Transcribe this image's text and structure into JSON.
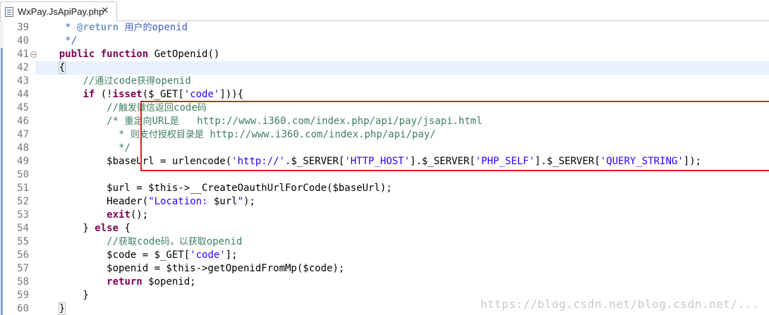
{
  "tab": {
    "title": "WxPay.JsApiPay.php",
    "close_glyph": "✕",
    "icon": "php-file-icon"
  },
  "lines": [
    {
      "num": "39",
      "tokens": [
        [
          "jd",
          "     * "
        ],
        [
          "jt",
          "@return"
        ],
        [
          "jd",
          " "
        ],
        [
          "jj",
          "用户的"
        ],
        [
          "jd",
          "openid"
        ]
      ]
    },
    {
      "num": "40",
      "tokens": [
        [
          "jd",
          "     */"
        ]
      ]
    },
    {
      "num": "41",
      "fold": true,
      "tokens": [
        [
          "var",
          "    "
        ],
        [
          "kw",
          "public"
        ],
        [
          "var",
          " "
        ],
        [
          "kw",
          "function"
        ],
        [
          "var",
          " GetOpenid()"
        ]
      ]
    },
    {
      "num": "42",
      "current": true,
      "tokens": [
        [
          "var",
          "    "
        ],
        [
          "brk",
          "{"
        ]
      ]
    },
    {
      "num": "43",
      "tokens": [
        [
          "var",
          "        "
        ],
        [
          "cm",
          "//"
        ],
        [
          "cj",
          "通过"
        ],
        [
          "cm",
          "code"
        ],
        [
          "cj",
          "获得"
        ],
        [
          "cm",
          "openid"
        ]
      ]
    },
    {
      "num": "44",
      "tokens": [
        [
          "var",
          "        "
        ],
        [
          "kw",
          "if"
        ],
        [
          "var",
          " (!"
        ],
        [
          "kw",
          "isset"
        ],
        [
          "var",
          "($_GET["
        ],
        [
          "str",
          "'code'"
        ],
        [
          "var",
          "])){"
        ]
      ]
    },
    {
      "num": "45",
      "tokens": [
        [
          "var",
          "            "
        ],
        [
          "cm",
          "//"
        ],
        [
          "cj",
          "触发微信返回"
        ],
        [
          "cm",
          "code"
        ],
        [
          "cj",
          "码"
        ]
      ]
    },
    {
      "num": "46",
      "tokens": [
        [
          "var",
          "            "
        ],
        [
          "cm",
          "/* "
        ],
        [
          "cj",
          "重定向"
        ],
        [
          "cm",
          "URL"
        ],
        [
          "cj",
          "是"
        ],
        [
          "cm",
          "   http://www.i360.com/index.php/api/pay/jsapi.html"
        ]
      ]
    },
    {
      "num": "47",
      "tokens": [
        [
          "var",
          "            "
        ],
        [
          "cm",
          "  * "
        ],
        [
          "cj",
          "则支付授权目录是"
        ],
        [
          "cm",
          " http://www.i360.com/index.php/api/pay/"
        ]
      ]
    },
    {
      "num": "48",
      "tokens": [
        [
          "var",
          "            "
        ],
        [
          "cm",
          "  */"
        ]
      ]
    },
    {
      "num": "49",
      "tokens": [
        [
          "var",
          "            $baseUrl = urlencode("
        ],
        [
          "str",
          "'http://'"
        ],
        [
          "var",
          ".$_SERVER["
        ],
        [
          "str",
          "'HTTP_HOST'"
        ],
        [
          "var",
          "].$_SERVER["
        ],
        [
          "str",
          "'PHP_SELF'"
        ],
        [
          "var",
          "].$_SERVER["
        ],
        [
          "str",
          "'QUERY_STRING'"
        ],
        [
          "var",
          "]);"
        ]
      ]
    },
    {
      "num": "50",
      "tokens": []
    },
    {
      "num": "51",
      "tokens": [
        [
          "var",
          "            $url = $this->__CreateOauthUrlForCode($baseUrl);"
        ]
      ]
    },
    {
      "num": "52",
      "tokens": [
        [
          "var",
          "            Header("
        ],
        [
          "str",
          "\"Location: "
        ],
        [
          "var",
          "$url"
        ],
        [
          "str",
          "\""
        ],
        [
          "var",
          ");"
        ]
      ]
    },
    {
      "num": "53",
      "tokens": [
        [
          "var",
          "            "
        ],
        [
          "kw",
          "exit"
        ],
        [
          "var",
          "();"
        ]
      ]
    },
    {
      "num": "54",
      "tokens": [
        [
          "var",
          "        } "
        ],
        [
          "kw",
          "else"
        ],
        [
          "var",
          " {"
        ]
      ]
    },
    {
      "num": "55",
      "tokens": [
        [
          "var",
          "            "
        ],
        [
          "cm",
          "//"
        ],
        [
          "cj",
          "获取"
        ],
        [
          "cm",
          "code"
        ],
        [
          "cj",
          "码，以获取"
        ],
        [
          "cm",
          "openid"
        ]
      ]
    },
    {
      "num": "56",
      "tokens": [
        [
          "var",
          "            $code = $_GET["
        ],
        [
          "str",
          "'code'"
        ],
        [
          "var",
          "];"
        ]
      ]
    },
    {
      "num": "57",
      "tokens": [
        [
          "var",
          "            $openid = $this->getOpenidFromMp($code);"
        ]
      ]
    },
    {
      "num": "58",
      "tokens": [
        [
          "var",
          "            "
        ],
        [
          "kw",
          "return"
        ],
        [
          "var",
          " $openid;"
        ]
      ]
    },
    {
      "num": "59",
      "tokens": [
        [
          "var",
          "        }"
        ]
      ]
    },
    {
      "num": "60",
      "tokens": [
        [
          "var",
          "    "
        ],
        [
          "brk",
          "}"
        ]
      ]
    }
  ],
  "watermark": "https://blog.csdn.net/blog.csdn.net/..."
}
